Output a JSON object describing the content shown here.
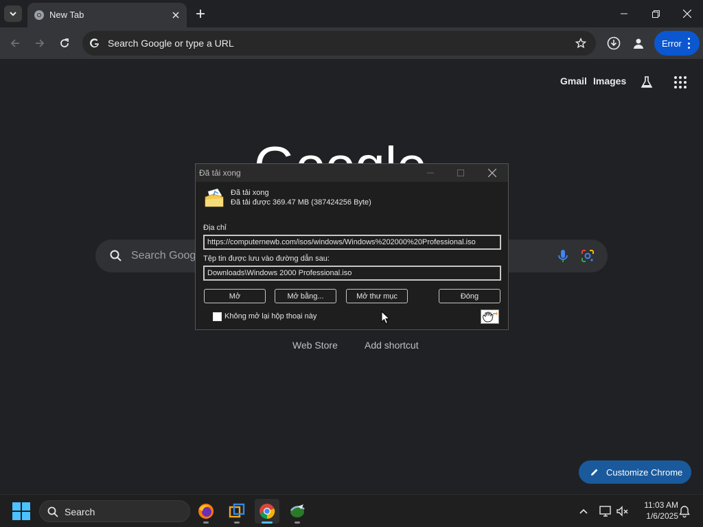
{
  "browser": {
    "tab": {
      "title": "New Tab"
    },
    "omnibox": {
      "placeholder": "Search Google or type a URL"
    },
    "profile_chip": {
      "label": "Error"
    }
  },
  "ntp": {
    "links": {
      "gmail": "Gmail",
      "images": "Images"
    },
    "logo_text": "Google",
    "search_placeholder": "Search Google or type a URL",
    "shortcuts": [
      {
        "label": "Web Store"
      },
      {
        "label": "Add shortcut"
      }
    ],
    "customize_label": "Customize Chrome"
  },
  "dialog": {
    "title": "Đã tải xong",
    "status_heading": "Đã tải xong",
    "status_detail": "Đã tải được 369.47  MB (387424256 Byte)",
    "address_label": "Địa chỉ",
    "address_value": "https://computernewb.com/isos/windows/Windows%202000%20Professional.iso",
    "saved_path_label": "Tệp tin được lưu vào đường dẫn sau:",
    "saved_path_value": "Downloads\\Windows 2000 Professional.iso",
    "buttons": {
      "open": "Mở",
      "open_with": "Mở bằng...",
      "open_folder": "Mở thư mục",
      "close": "Đóng"
    },
    "checkbox_label": "Không mở lại hộp thoại này",
    "checkbox_checked": false
  },
  "taskbar": {
    "search_label": "Search",
    "apps": [
      {
        "name": "Firefox",
        "icon": "firefox-icon"
      },
      {
        "name": "Virtual Machine",
        "icon": "vm-icon"
      },
      {
        "name": "Chrome",
        "icon": "chrome-icon",
        "active": true
      },
      {
        "name": "Internet Download Manager",
        "icon": "idm-icon"
      }
    ],
    "clock": {
      "time": "11:03 AM",
      "date": "1/6/2025"
    }
  },
  "colors": {
    "accent": "#0b57d0",
    "windows_accent": "#4cc2ff",
    "background": "#202124"
  }
}
